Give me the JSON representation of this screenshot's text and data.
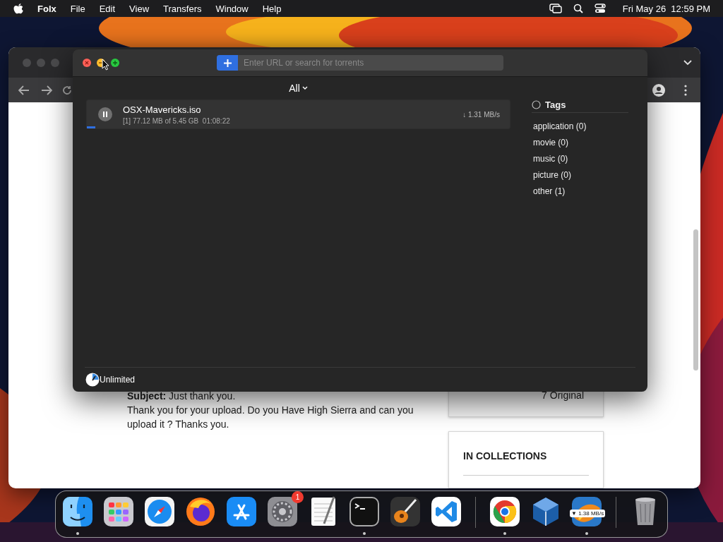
{
  "menu_bar": {
    "app_name": "Folx",
    "menus": [
      "File",
      "Edit",
      "View",
      "Transfers",
      "Window",
      "Help"
    ],
    "clock": "Fri May 26  12:59 PM"
  },
  "browser": {
    "comment_subject": "**Subject:** Just thank you.",
    "comment_body": "Thank you for your upload. Do you Have High Sierra and can you upload it ? Thanks you.",
    "stats_card": "7 Original",
    "collections_heading": "IN COLLECTIONS"
  },
  "folx": {
    "search": {
      "placeholder": "Enter URL or search for torrents"
    },
    "filter": "All",
    "downloads": [
      {
        "name": "OSX-Mavericks.iso",
        "details": "[1] 77.12 MB of 5.45 GB  01:08:22",
        "speed": "↓ 1.31 MB/s",
        "paused": false,
        "level": 0.02
      }
    ],
    "tags": {
      "title": "Tags",
      "items": [
        "application (0)",
        "movie (0)",
        "music (0)",
        "picture (0)",
        "other (1)"
      ]
    },
    "speed_limit": "Unlimited"
  },
  "dock": {
    "groups": [
      {
        "items": [
          {
            "kind": "finder",
            "running": true
          },
          {
            "kind": "launchpad",
            "running": false
          },
          {
            "kind": "safari",
            "running": false
          },
          {
            "kind": "firefox",
            "running": false
          },
          {
            "kind": "appstore",
            "running": false
          },
          {
            "kind": "settings",
            "running": false,
            "badge": "1"
          },
          {
            "kind": "textedit",
            "running": false
          },
          {
            "kind": "terminal",
            "running": true
          },
          {
            "kind": "garageband",
            "running": false
          },
          {
            "kind": "vscode",
            "running": false
          }
        ]
      },
      {
        "items": [
          {
            "kind": "chrome",
            "running": true
          },
          {
            "kind": "virtualbox",
            "running": false
          },
          {
            "kind": "folx",
            "running": true,
            "badge": "▼ 1.38 MB/s"
          }
        ]
      },
      {
        "items": [
          {
            "kind": "trash",
            "running": false
          }
        ]
      }
    ]
  }
}
